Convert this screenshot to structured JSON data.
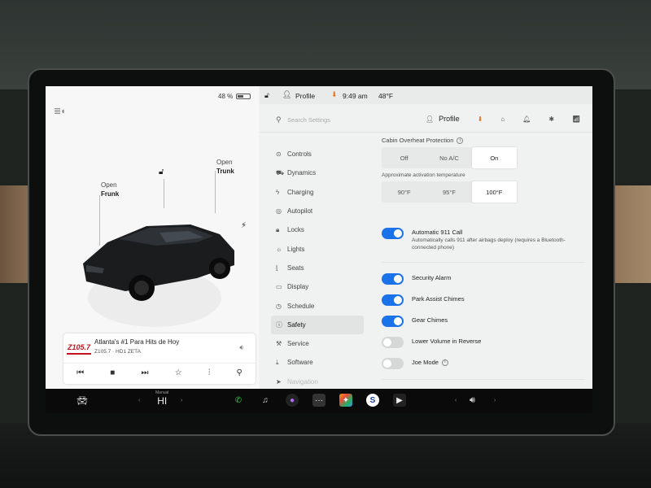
{
  "battery": {
    "percent": "48 %"
  },
  "car": {
    "frunk_label_1": "Open",
    "frunk_label_2": "Frunk",
    "trunk_label_1": "Open",
    "trunk_label_2": "Trunk"
  },
  "media": {
    "station_logo": "Z105.7",
    "title": "Atlanta's #1 Para Hits de Hoy",
    "subtitle": "Z105.7 · HD1 ZETA"
  },
  "status_bar": {
    "profile": "Profile",
    "time": "9:49 am",
    "temperature": "48°F"
  },
  "search": {
    "placeholder": "Search Settings"
  },
  "header": {
    "profile_label": "Profile"
  },
  "nav": {
    "items": [
      {
        "label": "Controls",
        "icon": "toggle-icon"
      },
      {
        "label": "Dynamics",
        "icon": "car-icon"
      },
      {
        "label": "Charging",
        "icon": "bolt-icon"
      },
      {
        "label": "Autopilot",
        "icon": "steering-wheel-icon"
      },
      {
        "label": "Locks",
        "icon": "lock-icon"
      },
      {
        "label": "Lights",
        "icon": "light-icon"
      },
      {
        "label": "Seats",
        "icon": "seat-icon"
      },
      {
        "label": "Display",
        "icon": "display-icon"
      },
      {
        "label": "Schedule",
        "icon": "schedule-icon"
      },
      {
        "label": "Safety",
        "icon": "safety-icon"
      },
      {
        "label": "Service",
        "icon": "wrench-icon"
      },
      {
        "label": "Software",
        "icon": "download-icon"
      },
      {
        "label": "Navigation",
        "icon": "navigation-icon"
      }
    ],
    "active": "Safety"
  },
  "safety": {
    "cabin_overheat_label": "Cabin Overheat Protection",
    "cabin_options": [
      "Off",
      "No A/C",
      "On"
    ],
    "cabin_selected": "On",
    "activation_temp_label": "Approximate activation temperature",
    "temp_options": [
      "90°F",
      "95°F",
      "100°F"
    ],
    "temp_selected": "100°F",
    "auto_911_title": "Automatic 911 Call",
    "auto_911_desc": "Automatically calls 911 after airbags deploy (requires a Bluetooth-connected phone)",
    "auto_911_on": true,
    "security_alarm": "Security Alarm",
    "park_assist": "Park Assist Chimes",
    "gear_chimes": "Gear Chimes",
    "lower_volume": "Lower Volume in Reverse",
    "joe_mode": "Joe Mode"
  },
  "bottom_bar": {
    "climate_mode": "Manual",
    "climate_temp": "HI"
  },
  "colors": {
    "accent": "#1a73e8",
    "download": "#e87722",
    "phone": "#2ecc40",
    "station": "#c1121f"
  }
}
